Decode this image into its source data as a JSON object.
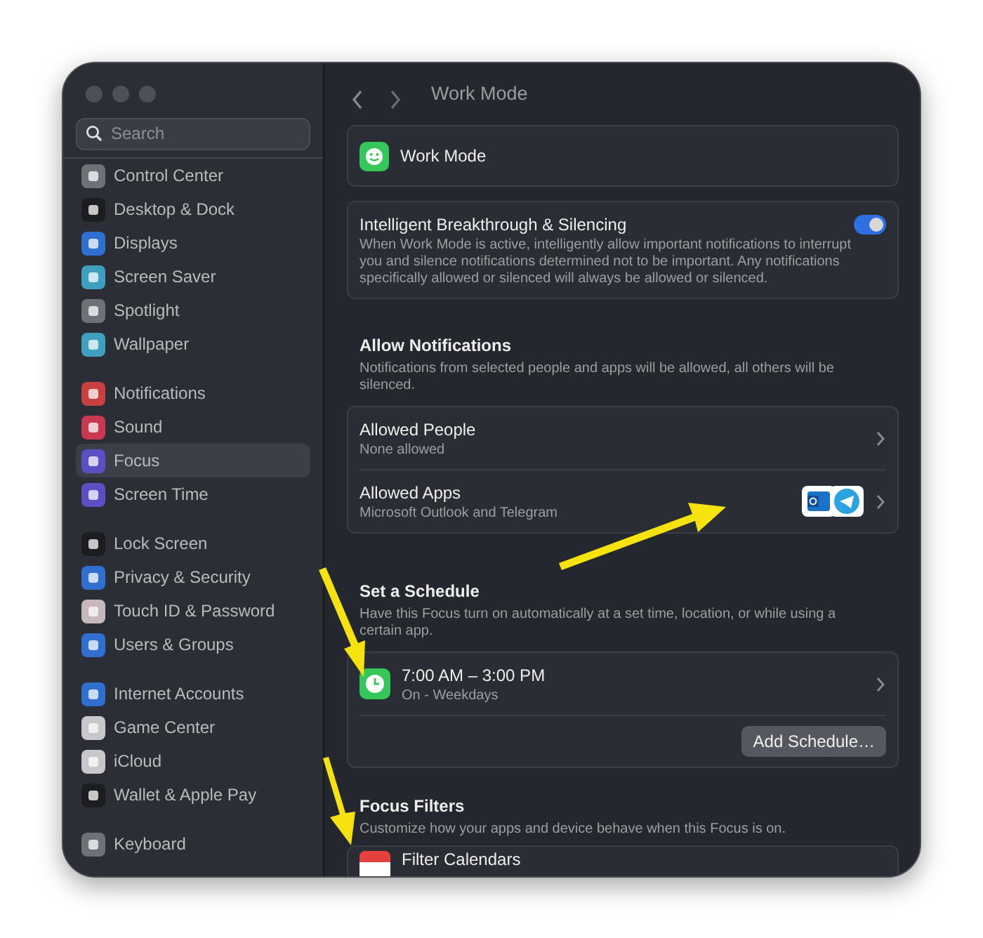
{
  "sidebar": {
    "search": {
      "placeholder": "Search"
    },
    "groups": [
      [
        {
          "label": "Control Center",
          "color": "#6e7177",
          "selected": false
        },
        {
          "label": "Desktop & Dock",
          "color": "#1c1d20",
          "selected": false
        },
        {
          "label": "Displays",
          "color": "#2f6fd0",
          "selected": false
        },
        {
          "label": "Screen Saver",
          "color": "#3f9fbf",
          "selected": false
        },
        {
          "label": "Spotlight",
          "color": "#6e7177",
          "selected": false
        },
        {
          "label": "Wallpaper",
          "color": "#3f9fbf",
          "selected": false
        }
      ],
      [
        {
          "label": "Notifications",
          "color": "#c8403f",
          "selected": false
        },
        {
          "label": "Sound",
          "color": "#c8384f",
          "selected": false
        },
        {
          "label": "Focus",
          "color": "#5b4fc4",
          "selected": true
        },
        {
          "label": "Screen Time",
          "color": "#5b4fc4",
          "selected": false
        }
      ],
      [
        {
          "label": "Lock Screen",
          "color": "#1c1d20",
          "selected": false
        },
        {
          "label": "Privacy & Security",
          "color": "#2f6fd0",
          "selected": false
        },
        {
          "label": "Touch ID & Password",
          "color": "#c6b8bc",
          "selected": false
        },
        {
          "label": "Users & Groups",
          "color": "#2f6fd0",
          "selected": false
        }
      ],
      [
        {
          "label": "Internet Accounts",
          "color": "#2f6fd0",
          "selected": false
        },
        {
          "label": "Game Center",
          "color": "#c8c8cc",
          "selected": false
        },
        {
          "label": "iCloud",
          "color": "#c8c8cc",
          "selected": false
        },
        {
          "label": "Wallet & Apple Pay",
          "color": "#1c1d20",
          "selected": false
        }
      ],
      [
        {
          "label": "Keyboard",
          "color": "#6e7177",
          "selected": false
        }
      ]
    ]
  },
  "toolbar": {
    "title": "Work Mode"
  },
  "focus_card": {
    "name": "Work Mode"
  },
  "breakthrough": {
    "title": "Intelligent Breakthrough & Silencing",
    "description": "When Work Mode is active, intelligently allow important notifications to interrupt you and silence notifications determined not to be important. Any notifications specifically allowed or silenced will always be allowed or silenced.",
    "on": true
  },
  "allow_notifications": {
    "title": "Allow Notifications",
    "description": "Notifications from selected people and apps will be allowed, all others will be silenced.",
    "rows": [
      {
        "kind": "plain",
        "title": "Allowed People",
        "subtitle": "None allowed"
      },
      {
        "kind": "apps",
        "title": "Allowed Apps",
        "subtitle": "Microsoft Outlook and Telegram"
      }
    ]
  },
  "schedule": {
    "title": "Set a Schedule",
    "description": "Have this Focus turn on automatically at a set time, location, or while using a certain app.",
    "entries": [
      {
        "time": "7:00 AM – 3:00 PM",
        "status": "On - Weekdays"
      }
    ],
    "button": "Add Schedule…"
  },
  "focus_filters": {
    "title": "Focus Filters",
    "description": "Customize how your apps and device behave when this Focus is on.",
    "rows": [
      {
        "title": "Filter Calendars"
      }
    ]
  }
}
